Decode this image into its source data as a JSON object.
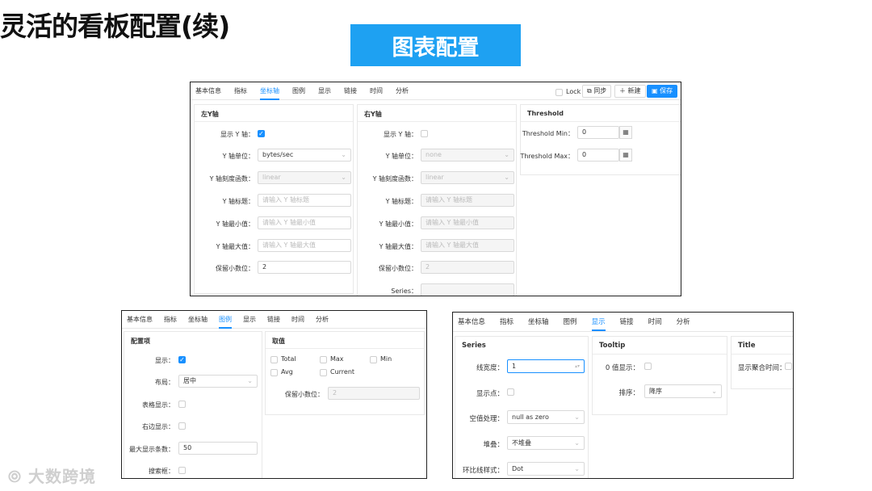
{
  "slide": {
    "title": "灵活的看板配置(续)",
    "badge": "图表配置",
    "watermark": "大数跨境"
  },
  "s1": {
    "tabs": [
      "基本信息",
      "指标",
      "坐标轴",
      "图例",
      "显示",
      "链接",
      "时间",
      "分析"
    ],
    "lock": "Lock",
    "sync": "同步",
    "create": "新建",
    "save": "保存",
    "left": {
      "title": "左Y轴",
      "show_y_label": "显示 Y 轴：",
      "unit_label": "Y 轴单位：",
      "unit_value": "bytes/sec",
      "scale_label": "Y 轴刻度函数：",
      "scale_value": "linear",
      "ytitle_label": "Y 轴标题：",
      "ytitle_ph": "请输入 Y 轴标题",
      "ymin_label": "Y 轴最小值：",
      "ymin_ph": "请输入 Y 轴最小值",
      "ymax_label": "Y 轴最大值：",
      "ymax_ph": "请输入 Y 轴最大值",
      "dec_label": "保留小数位：",
      "dec_value": "2"
    },
    "right": {
      "title": "右Y轴",
      "show_y_label": "显示 Y 轴：",
      "unit_label": "Y 轴单位：",
      "unit_value": "none",
      "scale_label": "Y 轴刻度函数：",
      "scale_value": "linear",
      "ytitle_label": "Y 轴标题：",
      "ytitle_ph": "请输入 Y 轴标题",
      "ymin_label": "Y 轴最小值：",
      "ymin_ph": "请输入 Y 轴最小值",
      "ymax_label": "Y 轴最大值：",
      "ymax_ph": "请输入 Y 轴最大值",
      "dec_label": "保留小数位：",
      "dec_value": "2",
      "series_label": "Series："
    },
    "threshold": {
      "title": "Threshold",
      "min_label": "Threshold Min：",
      "min_value": "0",
      "max_label": "Threshold Max：",
      "max_value": "0"
    }
  },
  "s2": {
    "tabs": [
      "基本信息",
      "指标",
      "坐标轴",
      "图例",
      "显示",
      "链接",
      "时间",
      "分析"
    ],
    "config": {
      "title": "配置项",
      "show_label": "显示：",
      "layout_label": "布局：",
      "layout_value": "居中",
      "table_label": "表格显示：",
      "right_label": "右边显示：",
      "max_label": "最大显示条数：",
      "max_value": "50",
      "search_label": "搜索框："
    },
    "values": {
      "title": "取值",
      "total": "Total",
      "max": "Max",
      "min": "Min",
      "avg": "Avg",
      "current": "Current",
      "dec_label": "保留小数位：",
      "dec_value": "2"
    }
  },
  "s3": {
    "tabs": [
      "基本信息",
      "指标",
      "坐标轴",
      "图例",
      "显示",
      "链接",
      "时间",
      "分析"
    ],
    "series": {
      "title": "Series",
      "line_width_label": "线宽度：",
      "line_width_value": "1",
      "points_label": "显示点：",
      "null_label": "空值处理：",
      "null_value": "null as zero",
      "stack_label": "堆叠：",
      "stack_value": "不堆叠",
      "compare_label": "环比线样式：",
      "compare_value": "Dot"
    },
    "tooltip": {
      "title": "Tooltip",
      "zero_label": "0 值显示：",
      "sort_label": "排序：",
      "sort_value": "降序"
    },
    "title_panel": {
      "title": "Title",
      "agg_label": "显示聚合时间："
    }
  }
}
